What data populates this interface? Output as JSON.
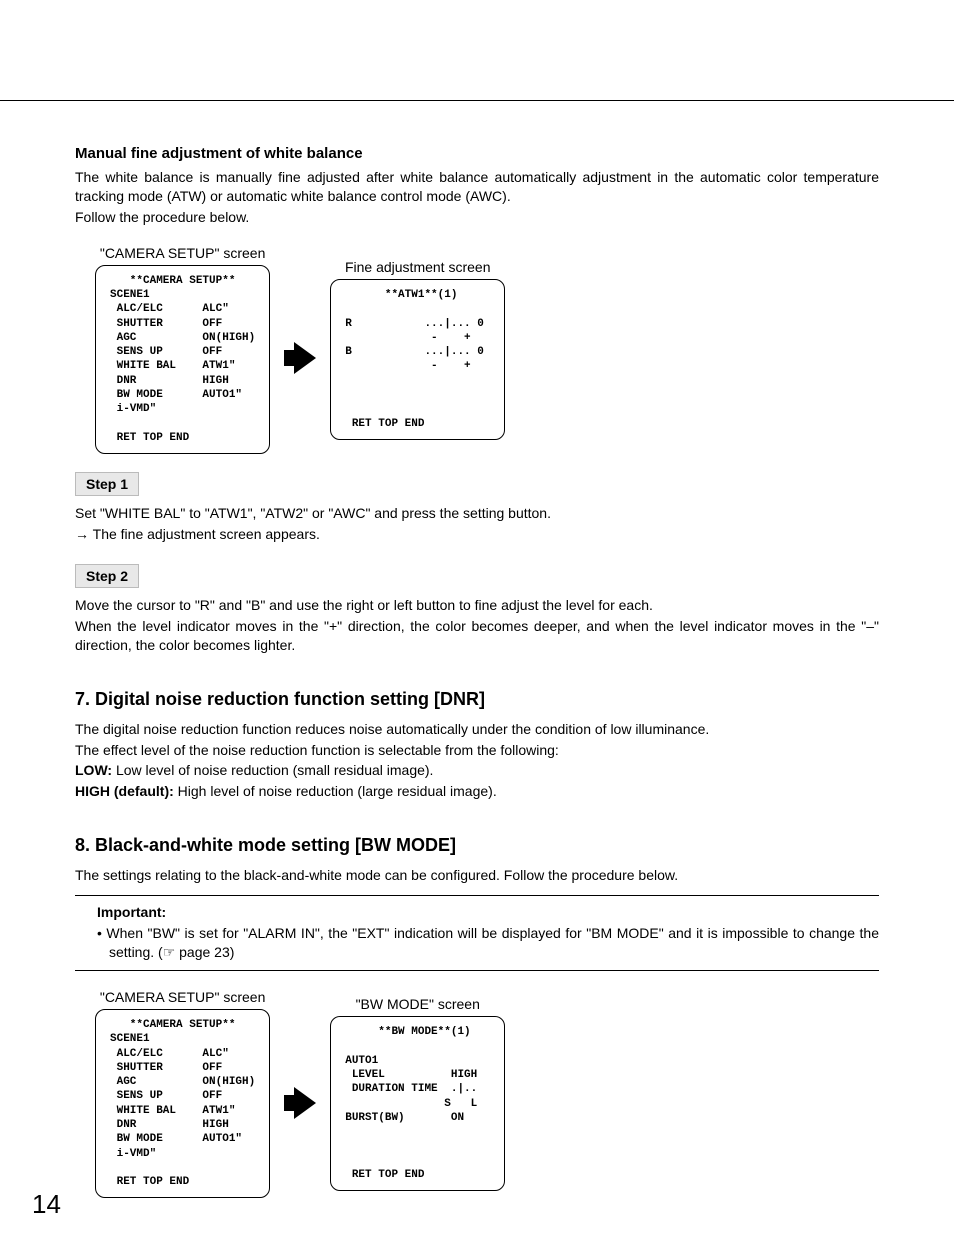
{
  "section_wb": {
    "heading": "Manual fine adjustment of white balance",
    "para1": "The white balance is manually fine adjusted after white balance automatically adjustment in the automatic color temperature tracking mode (ATW) or automatic white balance control mode (AWC).",
    "para2": "Follow the procedure below.",
    "screen1_caption": "\"CAMERA SETUP\" screen",
    "screen1_osd": "   **CAMERA SETUP**\nSCENE1\n ALC/ELC      ALC\"\n SHUTTER      OFF\n AGC          ON(HIGH)\n SENS UP      OFF\n WHITE BAL    ATW1\"\n DNR          HIGH\n BW MODE      AUTO1\"\n i-VMD\"\n\n RET TOP END",
    "screen2_caption": "Fine adjustment screen",
    "screen2_osd": "      **ATW1**(1)\n\nR           ...|... 0\n             -    +\nB           ...|... 0\n             -    +\n\n\n\n RET TOP END",
    "step1_label": "Step 1",
    "step1_text": "Set \"WHITE BAL\" to \"ATW1\", \"ATW2\" or \"AWC\" and press the setting button.",
    "step1_result": "The fine adjustment screen appears.",
    "step2_label": "Step 2",
    "step2_text1": "Move the cursor to \"R\" and \"B\" and use the right or left button to fine adjust the level for each.",
    "step2_text2": "When the level indicator moves in the \"+\" direction, the color becomes deeper, and when the level indicator moves in the \"–\" direction, the color becomes lighter."
  },
  "section_dnr": {
    "heading": "7. Digital noise reduction function setting [DNR]",
    "para1": "The digital noise reduction function reduces noise automatically under the condition of low illuminance.",
    "para2": "The effect level of the noise reduction function is selectable from the following:",
    "low_label": "LOW:",
    "low_text": " Low level of noise reduction (small residual image).",
    "high_label": "HIGH (default):",
    "high_text": " High level of noise reduction (large residual image)."
  },
  "section_bw": {
    "heading": "8. Black-and-white mode setting [BW MODE]",
    "para1": "The settings relating to the black-and-white mode can be configured. Follow the procedure below.",
    "important_label": "Important:",
    "important_item": "When \"BW\" is set for \"ALARM IN\", the \"EXT\" indication will be displayed for \"BM MODE\" and it is impossible to change the setting. (☞ page 23)",
    "screen1_caption": "\"CAMERA SETUP\" screen",
    "screen1_osd": "   **CAMERA SETUP**\nSCENE1\n ALC/ELC      ALC\"\n SHUTTER      OFF\n AGC          ON(HIGH)\n SENS UP      OFF\n WHITE BAL    ATW1\"\n DNR          HIGH\n BW MODE      AUTO1\"\n i-VMD\"\n\n RET TOP END",
    "screen2_caption": "\"BW MODE\" screen",
    "screen2_osd": "     **BW MODE**(1)\n\nAUTO1\n LEVEL          HIGH\n DURATION TIME  .|..\n               S   L\nBURST(BW)       ON\n\n\n\n RET TOP END"
  },
  "page_number": "14"
}
